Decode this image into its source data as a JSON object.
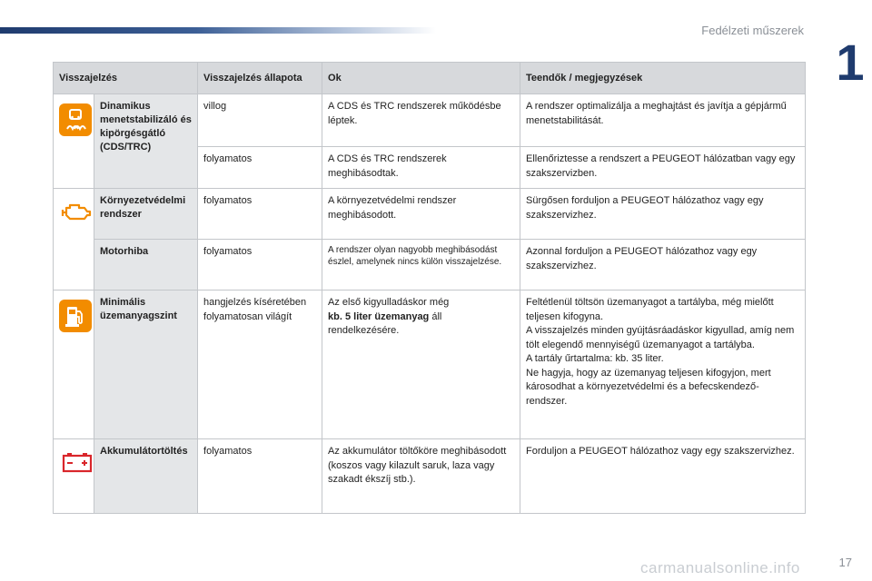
{
  "header": {
    "section_title": "Fedélzeti műszerek",
    "chapter": "1",
    "page_number": "17"
  },
  "watermark": "carmanualsonline.info",
  "table": {
    "columns": [
      "Visszajelzés",
      "Visszajelzés állapota",
      "Ok",
      "Teendők / megjegyzések"
    ],
    "rows": {
      "cds": {
        "icon": "skid-car-icon",
        "name": "Dinamikus menetstabilizáló és kipörgésgátló (CDS/TRC)",
        "sub": [
          {
            "state": "villog",
            "cause": "A CDS és TRC rendszerek működésbe léptek.",
            "action": "A rendszer optimalizálja a meghajtást és javítja a gépjármű menetstabilitását."
          },
          {
            "state": "folyamatos",
            "cause": "A CDS és TRC rendszerek meghibásodtak.",
            "action": "Ellenőriztesse a rendszert a PEUGEOT hálózatban vagy egy szakszervizben."
          }
        ]
      },
      "env": {
        "icon": "engine-icon",
        "name": "Környezetvédelmi rendszer",
        "state": "folyamatos",
        "cause": "A környezetvédelmi rendszer meghibásodott.",
        "action": "Sürgősen forduljon a PEUGEOT hálózathoz vagy egy szakszervizhez."
      },
      "engine": {
        "name": "Motorhiba",
        "state": "folyamatos",
        "cause": "A rendszer olyan nagyobb meghibásodást észlel, amelynek nincs külön visszajelzése.",
        "action": "Azonnal forduljon a PEUGEOT hálózathoz vagy egy szakszervizhez."
      },
      "fuel": {
        "icon": "fuel-pump-icon",
        "name": "Minimális üzemanyagszint",
        "state": "hangjelzés kíséretében folyamatosan világít",
        "cause_pre": "Az első kigyulladáskor még",
        "cause_bold": "kb. 5 liter üzemanyag",
        "cause_post": "áll rendelkezésére.",
        "action_lines": [
          "Feltétlenül töltsön üzemanyagot a tartályba, még mielőtt teljesen kifogyna.",
          "A visszajelzés minden gyújtásráadáskor kigyullad, amíg nem tölt elegendő mennyiségű üzemanyagot a tartályba.",
          "A tartály űrtartalma: kb. 35 liter.",
          "Ne hagyja, hogy az üzemanyag teljesen kifogyjon, mert károsodhat a környezetvédelmi és a befecskendező-rendszer."
        ]
      },
      "battery": {
        "icon": "battery-icon",
        "name": "Akkumulátortöltés",
        "state": "folyamatos",
        "cause": "Az akkumulátor töltőköre meghibásodott (koszos vagy kilazult saruk, laza vagy szakadt ékszíj stb.).",
        "action": "Forduljon a PEUGEOT hálózathoz vagy egy szakszervizhez."
      }
    }
  },
  "colors": {
    "amber": "#f28c00",
    "red": "#d9262b",
    "header_bg": "#d7d9dc",
    "name_bg": "#e4e6e8",
    "brand_blue": "#1f3b6e"
  }
}
